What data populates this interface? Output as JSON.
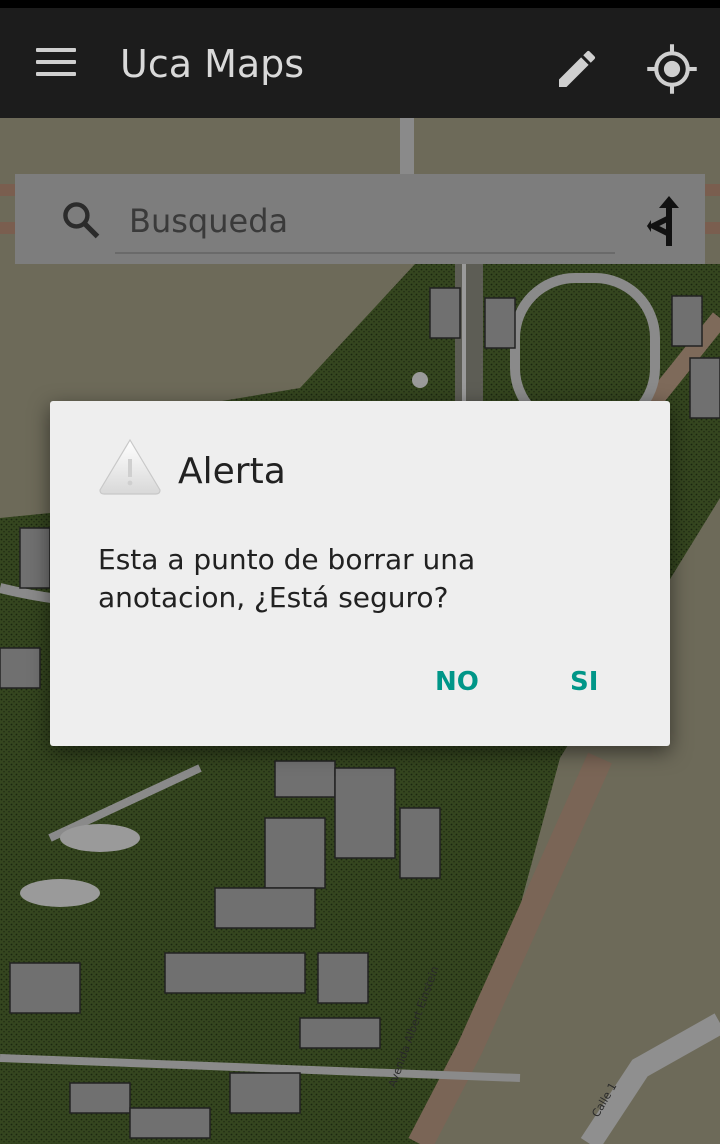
{
  "app": {
    "title": "Uca Maps"
  },
  "toolbar": {
    "menu_icon": "menu-icon",
    "edit_icon": "pencil-icon",
    "locate_icon": "my-location-icon"
  },
  "search": {
    "placeholder": "Busqueda",
    "icon": "search-icon",
    "route_icon": "route-turn-icon"
  },
  "map": {
    "street_labels": [
      "Avenida Albert Einstein",
      "Calle 1"
    ]
  },
  "dialog": {
    "icon": "warning-icon",
    "title": "Alerta",
    "message": "Esta a punto de borrar una anotacion, ¿Está seguro?",
    "buttons": {
      "no": "NO",
      "yes": "SI"
    },
    "accent_color": "#009688"
  }
}
